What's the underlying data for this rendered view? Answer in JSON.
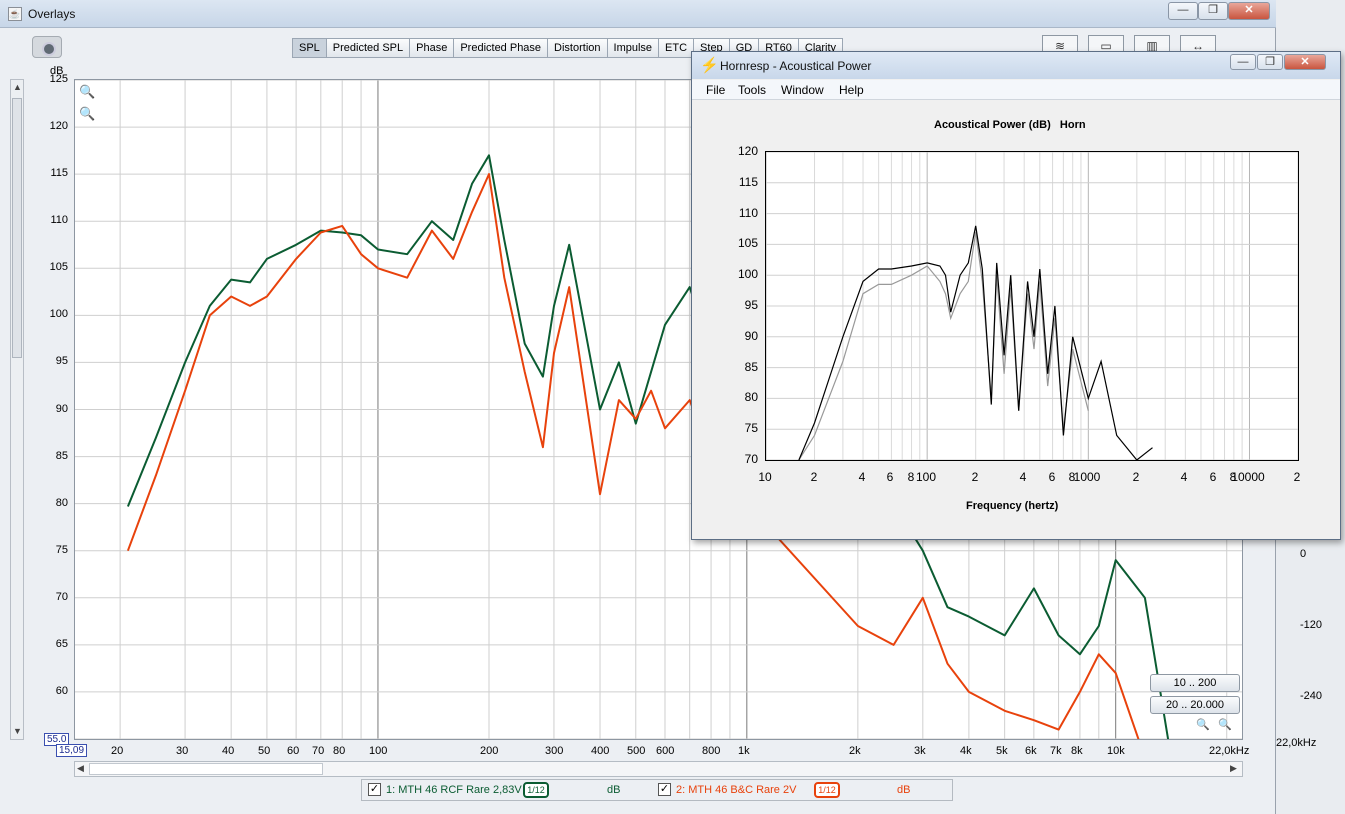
{
  "rew": {
    "title": "Overlays",
    "tabs": [
      "SPL",
      "Predicted SPL",
      "Phase",
      "Predicted Phase",
      "Distortion",
      "Impulse",
      "ETC",
      "Step",
      "GD",
      "RT60",
      "Clarity"
    ],
    "active_tab": "SPL",
    "y_unit": "dB",
    "y_ticks": [
      "125",
      "120",
      "115",
      "110",
      "105",
      "100",
      "95",
      "90",
      "85",
      "80",
      "75",
      "70",
      "65",
      "60"
    ],
    "y_min_readout": "55.0",
    "x_min_readout": "15,09",
    "x_ticks": [
      "20",
      "30",
      "40",
      "50",
      "60",
      "70",
      "80",
      "100",
      "200",
      "300",
      "400",
      "500",
      "600",
      "800",
      "1k",
      "2k",
      "3k",
      "4k",
      "5k",
      "6k",
      "7k",
      "8k",
      "10k",
      "22,0kHz"
    ],
    "right_axis_ticks": [
      "0",
      "-120",
      "-240"
    ],
    "right_axis_readout": "22,0kHz",
    "range_buttons": [
      "10 .. 200",
      "20 .. 20.000"
    ],
    "legend": [
      {
        "label": "1: MTH 46 RCF Rare 2,83V",
        "smoothing": "1/12",
        "unit": "dB",
        "color": "#0b5c32"
      },
      {
        "label": "2: MTH 46 B&C Rare 2V",
        "smoothing": "1/12",
        "unit": "dB",
        "color": "#e8420c"
      }
    ]
  },
  "chart_data": [
    {
      "type": "line",
      "title": "",
      "ylabel": "dB",
      "xscale": "log",
      "xlim": [
        15.09,
        22000
      ],
      "ylim": [
        55,
        125
      ],
      "series": [
        {
          "name": "1: MTH 46 RCF Rare 2,83V",
          "color": "#0b5c32",
          "x": [
            21,
            25,
            30,
            35,
            40,
            45,
            50,
            60,
            70,
            80,
            90,
            100,
            120,
            140,
            160,
            180,
            200,
            220,
            250,
            280,
            300,
            330,
            400,
            450,
            500,
            550,
            600,
            700,
            800,
            1000,
            2000,
            2500,
            3000,
            3500,
            4000,
            5000,
            6000,
            7000,
            8000,
            9000,
            10000,
            12000,
            14000
          ],
          "y": [
            79.7,
            87,
            95,
            101,
            103.8,
            103.5,
            106,
            107.5,
            109,
            108.8,
            108.5,
            107,
            106.5,
            110,
            108,
            114,
            117,
            108,
            97,
            93.5,
            101,
            107.5,
            90,
            95,
            88.5,
            94,
            99,
            103,
            96,
            95,
            84,
            80,
            75,
            69,
            68,
            66,
            71,
            66,
            64,
            67,
            74,
            70,
            54
          ]
        },
        {
          "name": "2: MTH 46 B&C Rare 2V",
          "color": "#e8420c",
          "x": [
            21,
            25,
            30,
            35,
            40,
            45,
            50,
            60,
            70,
            80,
            90,
            100,
            120,
            140,
            160,
            180,
            200,
            220,
            250,
            280,
            300,
            330,
            400,
            450,
            500,
            550,
            600,
            700,
            800,
            1000,
            2000,
            2500,
            3000,
            3500,
            4000,
            5000,
            6000,
            7000,
            8000,
            9000,
            10000,
            12000
          ],
          "y": [
            75,
            83,
            92,
            100,
            102,
            101,
            102,
            106,
            108.8,
            109.5,
            106.5,
            105,
            104,
            109,
            106,
            111,
            115,
            104,
            94,
            86,
            96,
            103,
            81,
            91,
            89,
            92,
            88,
            91,
            85,
            80,
            67,
            65,
            70,
            63,
            60,
            58,
            57,
            56,
            60,
            64,
            62,
            53
          ]
        }
      ]
    },
    {
      "type": "line",
      "title": "Acoustical Power (dB)   Horn",
      "xlabel": "Frequency (hertz)",
      "ylabel": "",
      "xscale": "log",
      "xlim": [
        10,
        20000
      ],
      "ylim": [
        70,
        120
      ],
      "x_tick_labels": [
        "10",
        "2",
        "4",
        "6",
        "8",
        "100",
        "2",
        "4",
        "6",
        "8",
        "1000",
        "2",
        "4",
        "6",
        "8",
        "10000",
        "2"
      ],
      "y_tick_labels": [
        "120",
        "115",
        "110",
        "105",
        "100",
        "95",
        "90",
        "85",
        "80",
        "75",
        "70"
      ],
      "series": [
        {
          "name": "",
          "color": "#000000",
          "x": [
            16,
            20,
            30,
            40,
            50,
            60,
            80,
            100,
            120,
            130,
            140,
            160,
            180,
            200,
            220,
            250,
            270,
            300,
            330,
            370,
            420,
            460,
            500,
            560,
            620,
            700,
            800,
            1000,
            1200,
            1500,
            2000,
            2500
          ],
          "y": [
            70,
            76,
            90,
            99,
            101,
            101,
            101.5,
            102,
            101.5,
            100,
            94,
            100,
            102,
            108,
            101,
            79,
            102,
            87,
            100,
            78,
            99,
            90,
            101,
            84,
            95,
            74,
            90,
            80,
            86,
            74,
            70,
            72
          ]
        },
        {
          "name": "",
          "color": "#999999",
          "x": [
            16,
            20,
            30,
            40,
            50,
            60,
            80,
            100,
            120,
            130,
            140,
            160,
            180,
            200,
            220,
            250,
            270,
            300,
            330,
            370,
            420,
            460,
            500,
            560,
            620,
            700,
            800,
            1000
          ],
          "y": [
            70,
            74,
            86,
            97,
            98.5,
            98.5,
            100,
            101.5,
            99,
            97,
            93,
            97,
            99,
            107,
            99,
            80,
            100,
            84,
            98,
            78,
            97,
            88,
            99,
            82,
            93,
            75,
            88,
            78
          ]
        }
      ]
    }
  ],
  "hornresp": {
    "title": "Hornresp - Acoustical Power",
    "menu": [
      "File",
      "Tools",
      "Window",
      "Help"
    ],
    "plot_title": "Acoustical Power (dB)   Horn",
    "x_label": "Frequency (hertz)"
  }
}
